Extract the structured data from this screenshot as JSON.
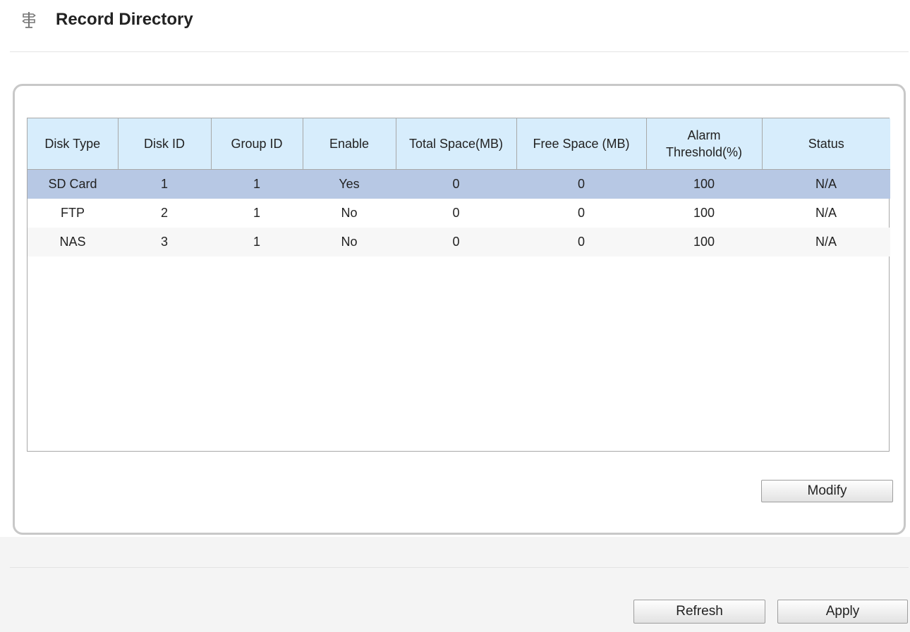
{
  "header": {
    "title": "Record Directory",
    "icon": "signpost-icon"
  },
  "table": {
    "columns": [
      {
        "label": "Disk Type"
      },
      {
        "label": "Disk ID"
      },
      {
        "label": "Group ID"
      },
      {
        "label": "Enable"
      },
      {
        "label": "Total Space(MB)"
      },
      {
        "label": "Free Space (MB)"
      },
      {
        "label": "Alarm Threshold(%)"
      },
      {
        "label": "Status"
      }
    ],
    "rows": [
      {
        "cells": [
          "SD Card",
          "1",
          "1",
          "Yes",
          "0",
          "0",
          "100",
          "N/A"
        ],
        "selected": true
      },
      {
        "cells": [
          "FTP",
          "2",
          "1",
          "No",
          "0",
          "0",
          "100",
          "N/A"
        ]
      },
      {
        "cells": [
          "NAS",
          "3",
          "1",
          "No",
          "0",
          "0",
          "100",
          "N/A"
        ]
      }
    ]
  },
  "buttons": {
    "modify": "Modify",
    "refresh": "Refresh",
    "apply": "Apply"
  },
  "colors": {
    "header_background": "#d7edfc",
    "selected_row": "#b7c8e4",
    "alternate_row": "#f7f7f7",
    "panel_border": "#c8c8c8"
  }
}
